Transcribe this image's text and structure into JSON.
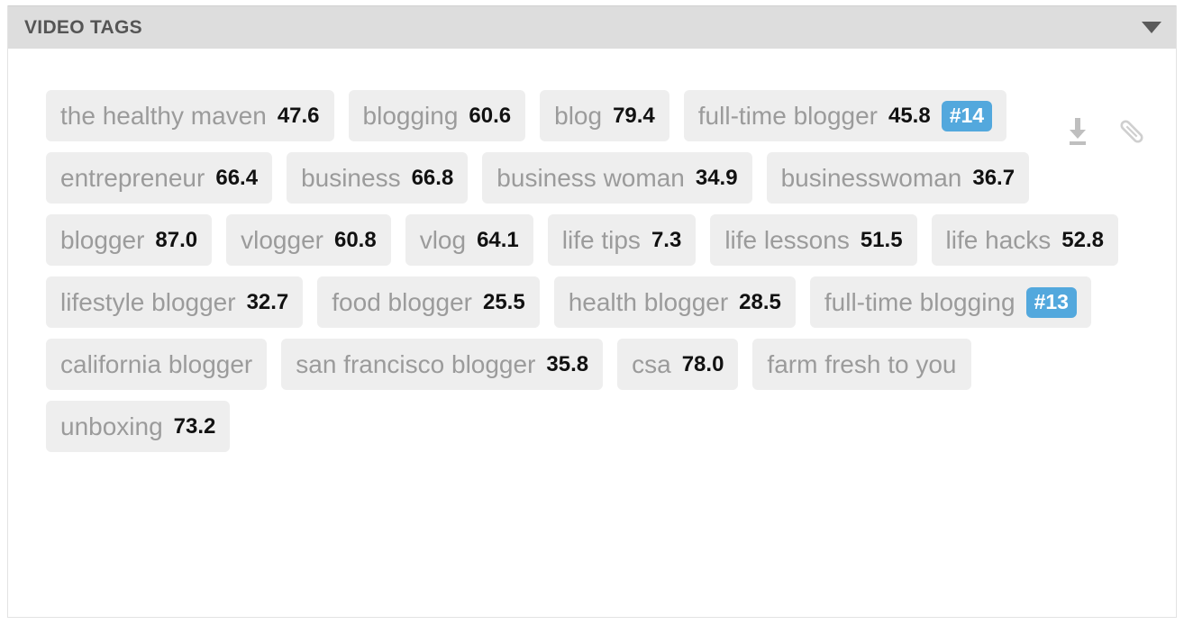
{
  "panel": {
    "title": "VIDEO TAGS",
    "collapse_icon": "chevron-down-icon",
    "accent_color": "#53a8dd",
    "tag_background": "#eeeeee",
    "header_background": "#dddddd"
  },
  "actions": [
    {
      "name": "download-icon",
      "label": "download"
    },
    {
      "name": "paperclip-icon",
      "label": "attach"
    }
  ],
  "tags": [
    {
      "label": "the healthy maven",
      "value": "47.6",
      "rank": ""
    },
    {
      "label": "blogging",
      "value": "60.6",
      "rank": ""
    },
    {
      "label": "blog",
      "value": "79.4",
      "rank": ""
    },
    {
      "label": "full-time blogger",
      "value": "45.8",
      "rank": "#14"
    },
    {
      "label": "entrepreneur",
      "value": "66.4",
      "rank": ""
    },
    {
      "label": "business",
      "value": "66.8",
      "rank": ""
    },
    {
      "label": "business woman",
      "value": "34.9",
      "rank": ""
    },
    {
      "label": "businesswoman",
      "value": "36.7",
      "rank": ""
    },
    {
      "label": "blogger",
      "value": "87.0",
      "rank": ""
    },
    {
      "label": "vlogger",
      "value": "60.8",
      "rank": ""
    },
    {
      "label": "vlog",
      "value": "64.1",
      "rank": ""
    },
    {
      "label": "life tips",
      "value": "7.3",
      "rank": ""
    },
    {
      "label": "life lessons",
      "value": "51.5",
      "rank": ""
    },
    {
      "label": "life hacks",
      "value": "52.8",
      "rank": ""
    },
    {
      "label": "lifestyle blogger",
      "value": "32.7",
      "rank": ""
    },
    {
      "label": "food blogger",
      "value": "25.5",
      "rank": ""
    },
    {
      "label": "health blogger",
      "value": "28.5",
      "rank": ""
    },
    {
      "label": "full-time blogging",
      "value": "",
      "rank": "#13"
    },
    {
      "label": "california blogger",
      "value": "",
      "rank": ""
    },
    {
      "label": "san francisco blogger",
      "value": "35.8",
      "rank": ""
    },
    {
      "label": "csa",
      "value": "78.0",
      "rank": ""
    },
    {
      "label": "farm fresh to you",
      "value": "",
      "rank": ""
    },
    {
      "label": "unboxing",
      "value": "73.2",
      "rank": ""
    }
  ]
}
